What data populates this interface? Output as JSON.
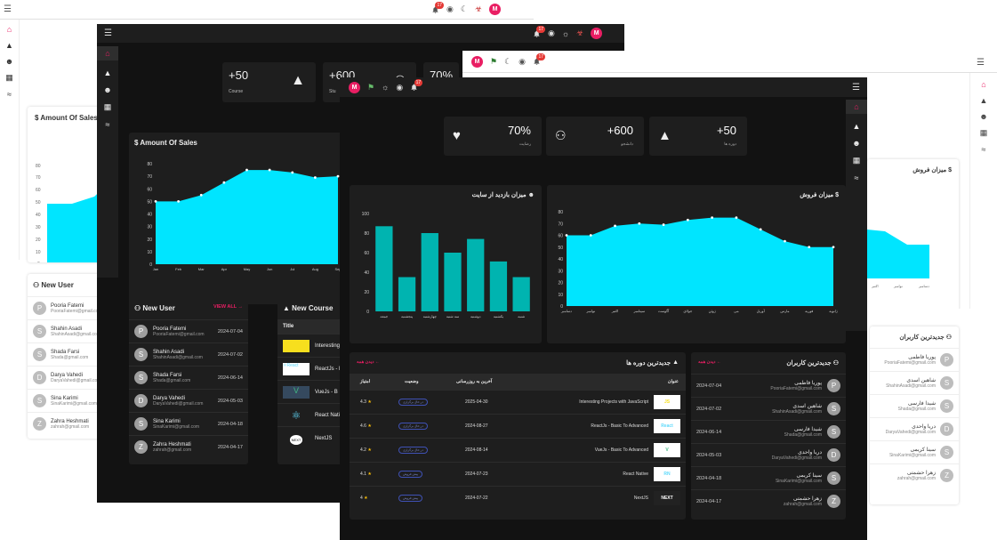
{
  "notifications": {
    "count": "17"
  },
  "user": {
    "initial": "M"
  },
  "stats_en": [
    {
      "value": "+50",
      "label": "Course"
    },
    {
      "value": "+600",
      "label": "Stu"
    },
    {
      "value": "70%",
      "label": ""
    }
  ],
  "stats_fa": [
    {
      "value": "+50",
      "label": "دوره ها"
    },
    {
      "value": "+600",
      "label": "دانشجو"
    },
    {
      "value": "70%",
      "label": "رضایت"
    }
  ],
  "titles": {
    "amount_sales": "Amount Of Sales",
    "new_user": "New User",
    "new_course": "New Course",
    "view_all": "VIEW ALL",
    "title_col": "Title",
    "fa_sales": "میزان فروش",
    "fa_visits": "میزان بازدید از سایت",
    "fa_new_users": "جدیدترین کاربران",
    "fa_new_courses": "جدیدترین دوره ها",
    "fa_view_all": "دیدن همه"
  },
  "users": [
    {
      "initial": "P",
      "name": "Pooria Fatemi",
      "email": "PooriaFatemi@gmail.com",
      "date": "2024-07-04",
      "fa_name": "پوریا فاطمی"
    },
    {
      "initial": "S",
      "name": "Shahin Asadi",
      "email": "ShahinAsadi@gmail.com",
      "date": "2024-07-02",
      "fa_name": "شاهین اسدی"
    },
    {
      "initial": "S",
      "name": "Shada Farsi",
      "email": "Shada@gmail.com",
      "date": "2024-06-14",
      "fa_name": "شیدا فارسی"
    },
    {
      "initial": "D",
      "name": "Darya Vahedi",
      "email": "DaryaVahedi@gmail.com",
      "date": "2024-05-03",
      "fa_name": "دریا واحدی"
    },
    {
      "initial": "S",
      "name": "Sina Karimi",
      "email": "SinaKarimi@gmail.com",
      "date": "2024-04-18",
      "fa_name": "سینا کریمی"
    },
    {
      "initial": "Z",
      "name": "Zahra Heshmati",
      "email": "zahrah@gmail.com",
      "date": "2024-04-17",
      "fa_name": "زهرا حشمتی"
    }
  ],
  "courses_en": [
    "Interesting",
    "ReactJs - B",
    "VueJs - B",
    "React Nati",
    "NextJS"
  ],
  "course_table": {
    "headers": {
      "title": "عنوان",
      "updated": "آخرین به روزرسانی",
      "status": "وضعیت",
      "score": "امتیاز"
    },
    "rows": [
      {
        "title": "Interesting Projects with JavaScript",
        "updated": "2025-04-30",
        "status": "در حال برگزاری",
        "score": "4.3",
        "logo": "JS",
        "logo_color": "#f7df1e"
      },
      {
        "title": "ReactJs - Basic To Advanced",
        "updated": "2024-08-27",
        "status": "در حال برگزاری",
        "score": "4.6",
        "logo": "React",
        "logo_color": "#61dafb"
      },
      {
        "title": "VueJs - Basic To Advanced",
        "updated": "2024-08-14",
        "status": "در حال برگزاری",
        "score": "4.2",
        "logo": "V",
        "logo_color": "#41b883"
      },
      {
        "title": "React Native",
        "updated": "2024-07-23",
        "status": "پیش فروش",
        "score": "4.1",
        "logo": "RN",
        "logo_color": "#61dafb"
      },
      {
        "title": "NextJS",
        "updated": "2024-07-22",
        "status": "پیش فروش",
        "score": "4",
        "logo": "NEXT",
        "logo_color": "#ffffff"
      }
    ]
  },
  "colors": {
    "accent": "#00e5ff",
    "bar": "#00b4b0",
    "brand": "#e91e63",
    "dark_bg": "#121212",
    "dark_card": "#1e1e1e"
  },
  "chart_data": [
    {
      "type": "area",
      "title": "Amount Of Sales",
      "categories": [
        "Jan",
        "Feb",
        "Mar",
        "Apr",
        "May",
        "Jun",
        "Jul",
        "Aug",
        "Sep"
      ],
      "values": [
        50,
        50,
        55,
        65,
        75,
        75,
        73,
        69,
        70
      ],
      "ylim": [
        0,
        80
      ],
      "yticks": [
        0,
        10,
        20,
        30,
        40,
        50,
        60,
        70,
        80
      ]
    },
    {
      "type": "area",
      "title": "میزان فروش",
      "categories": [
        "ژانویه",
        "فوریه",
        "مارس",
        "آوریل",
        "می",
        "ژوئن",
        "جولای",
        "آگوست",
        "سپتامبر",
        "اکتبر",
        "نوامبر",
        "دسامبر"
      ],
      "values": [
        50,
        50,
        55,
        65,
        75,
        75,
        73,
        69,
        70,
        68,
        60,
        60
      ],
      "ylim": [
        0,
        80
      ],
      "yticks": [
        0,
        10,
        20,
        30,
        40,
        50,
        60,
        70,
        80
      ]
    },
    {
      "type": "bar",
      "title": "میزان بازدید از سایت",
      "categories": [
        "شنبه",
        "یکشنبه",
        "دوشنبه",
        "سه شنبه",
        "چهارشنبه",
        "پنجشنبه",
        "جمعه"
      ],
      "values": [
        35,
        51,
        74,
        60,
        80,
        35,
        87
      ],
      "ylim": [
        0,
        100
      ],
      "yticks": [
        0,
        20,
        40,
        60,
        80,
        100
      ]
    }
  ]
}
